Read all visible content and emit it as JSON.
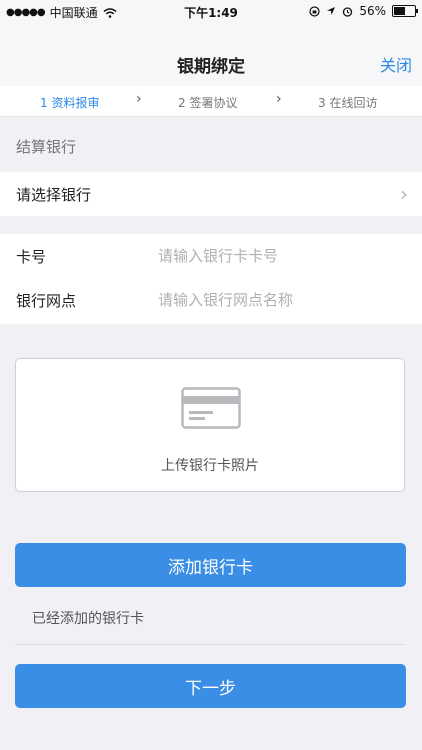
{
  "status_bar": {
    "carrier": "中国联通",
    "time": "下午1:49",
    "battery": "56%",
    "battery_level": 0.56
  },
  "nav": {
    "title": "银期绑定",
    "close_label": "关闭"
  },
  "steps": [
    {
      "label": "1 资料报审",
      "active": true
    },
    {
      "label": "2 签署协议",
      "active": false
    },
    {
      "label": "3 在线回访",
      "active": false
    }
  ],
  "section": {
    "settlement_bank_label": "结算银行"
  },
  "bank_select": {
    "label": "请选择银行"
  },
  "form": {
    "card_number": {
      "label": "卡号",
      "value": "",
      "placeholder": "请输入银行卡卡号"
    },
    "branch": {
      "label": "银行网点",
      "value": "",
      "placeholder": "请输入银行网点名称"
    }
  },
  "upload": {
    "label": "上传银行卡照片",
    "icon": "bank-card-icon"
  },
  "buttons": {
    "add_card": "添加银行卡",
    "next": "下一步"
  },
  "added_cards_label": "已经添加的银行卡",
  "colors": {
    "accent": "#2a8ae8",
    "button": "#3a8ee6",
    "background": "#f0f0f5"
  }
}
